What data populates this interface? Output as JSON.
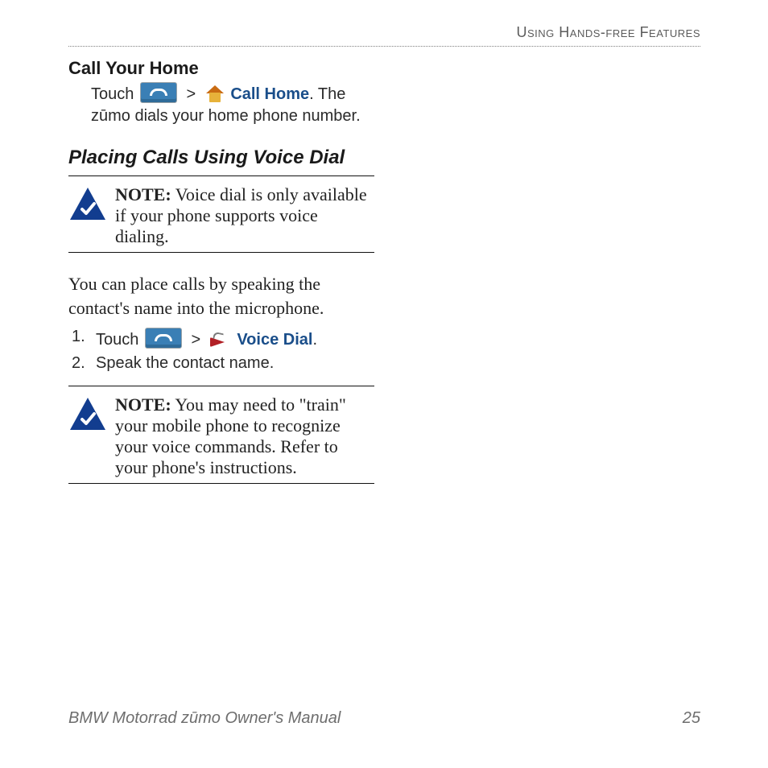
{
  "header": {
    "running": "Using Hands-free Features"
  },
  "s1": {
    "title": "Call Your Home",
    "touch": "Touch",
    "sep": ">",
    "link": "Call Home",
    "after": ". The zūmo dials your home phone number."
  },
  "s2": {
    "title": "Placing Calls Using Voice Dial",
    "note1_label": "NOTE:",
    "note1_body": " Voice dial is only available if your phone supports voice dialing.",
    "lead": "You can place calls by speaking the contact's name into the microphone.",
    "step1_touch": "Touch",
    "step1_sep": ">",
    "step1_link": "Voice Dial",
    "step1_after": ".",
    "step2": "Speak the contact name.",
    "note2_label": "NOTE:",
    "note2_body": " You may need to \"train\" your mobile phone to recognize your voice commands. Refer to your phone's instructions."
  },
  "footer": {
    "title": "BMW Motorrad zūmo Owner's Manual",
    "page": "25"
  }
}
